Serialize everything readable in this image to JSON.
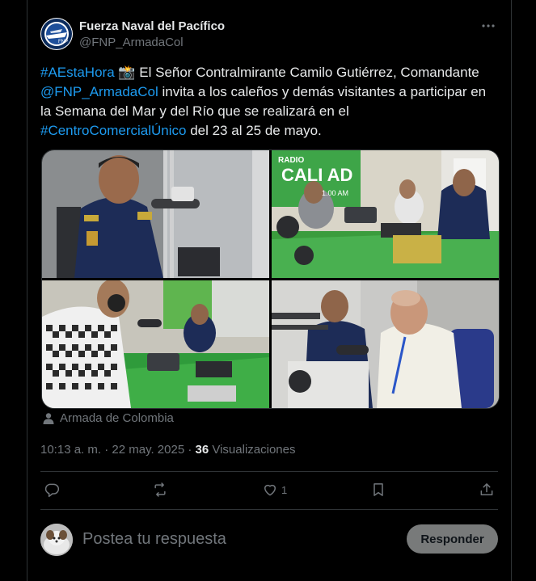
{
  "author": {
    "name": "Fuerza Naval del Pacífico",
    "handle": "@FNP_ArmadaCol"
  },
  "tweet": {
    "hashtag1": "#AEstaHora",
    "emoji": "📸",
    "text1": " El Señor Contralmirante Camilo Gutiérrez, Comandante ",
    "mention": "@FNP_ArmadaCol",
    "text2": " invita a los caleños y demás visitantes a participar  en la Semana del Mar y del Río que se realizará en el ",
    "hashtag2": "#CentroComercialÚnico",
    "text3": " del 23 al 25 de mayo."
  },
  "photos": {
    "sign_text": "CALI AD",
    "radio_text": "RADIO",
    "freq_text": "1.00 AM"
  },
  "tagged_user": "Armada de Colombia",
  "meta": {
    "time": "10:13 a. m.",
    "separator": " · ",
    "date": "22 may. 2025",
    "views_count": "36",
    "views_label": " Visualizaciones"
  },
  "actions": {
    "likes_count": "1"
  },
  "reply": {
    "placeholder": "Postea tu respuesta",
    "button_label": "Responder"
  },
  "colors": {
    "link": "#1d9bf0",
    "muted": "#71767b",
    "background": "#000000"
  }
}
